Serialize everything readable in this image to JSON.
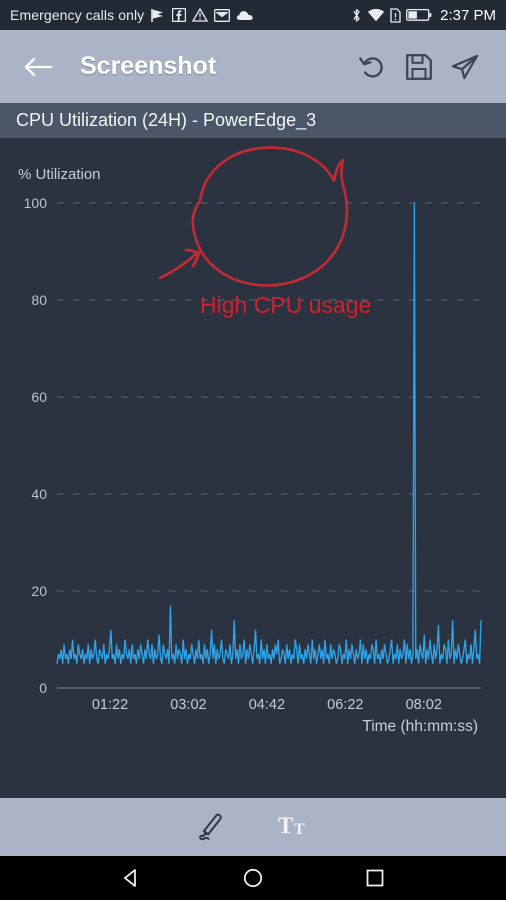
{
  "status_bar": {
    "carrier": "Emergency calls only",
    "clock": "2:37 PM",
    "left_icons": [
      "flag-icon",
      "facebook-icon",
      "warning-triangle-icon",
      "email-icon",
      "cloud-icon"
    ],
    "right_icons": [
      "bluetooth-icon",
      "wifi-icon",
      "sim-alert-icon",
      "battery-icon"
    ],
    "background": "#232a36"
  },
  "app_bar": {
    "back_label": "back-arrow",
    "title": "Screenshot",
    "actions": [
      {
        "name": "undo-button",
        "icon": "undo-icon"
      },
      {
        "name": "save-button",
        "icon": "floppy-disk-icon"
      },
      {
        "name": "share-button",
        "icon": "paper-plane-icon"
      }
    ],
    "background": "#aab4c6"
  },
  "subtitle": {
    "text": "CPU Utilization (24H) - PowerEdge_3",
    "background": "#4b5668"
  },
  "edit_toolbar": {
    "tools": [
      {
        "name": "draw-tool-button",
        "icon": "pen-icon",
        "selected": true
      },
      {
        "name": "text-tool-button",
        "icon": "text-format-icon",
        "selected": false
      }
    ],
    "background": "#aab4c6"
  },
  "nav_bar": {
    "buttons": [
      {
        "name": "nav-back-button",
        "icon": "triangle-back-icon"
      },
      {
        "name": "nav-home-button",
        "icon": "circle-home-icon"
      },
      {
        "name": "nav-recents-button",
        "icon": "square-recents-icon"
      }
    ],
    "background": "#000000"
  },
  "annotations": {
    "color": "#d32030",
    "text": "High CPU usage",
    "shapes": [
      "freehand-ellipse",
      "freehand-arrow"
    ]
  },
  "chart_data": {
    "type": "line",
    "title": "CPU Utilization (24H) - PowerEdge_3",
    "ylabel": "% Utilization",
    "xlabel": "Time (hh:mm:ss)",
    "ylim": [
      0,
      100
    ],
    "yticks": [
      0,
      20,
      40,
      60,
      80,
      100
    ],
    "ytick_labels": [
      "0",
      "20",
      "40",
      "60",
      "80",
      "100"
    ],
    "xtick_labels": [
      "01:22",
      "03:02",
      "04:42",
      "06:22",
      "08:02"
    ],
    "xtick_positions": [
      0.125,
      0.31,
      0.495,
      0.68,
      0.865
    ],
    "grid": "dashed-horizontal",
    "legend": "none",
    "line_color": "#2fa3e8",
    "background": "#2b3240",
    "series": [
      {
        "name": "CPU Utilization",
        "baseline": 6,
        "peak": 100,
        "peak_x_fraction": 0.825,
        "peak_label": "100",
        "secondary_peaks": [
          {
            "x_fraction": 0.215,
            "value": 17
          },
          {
            "x_fraction": 0.385,
            "value": 14
          },
          {
            "x_fraction": 0.44,
            "value": 12
          },
          {
            "x_fraction": 0.895,
            "value": 11
          },
          {
            "x_fraction": 0.955,
            "value": 13
          },
          {
            "x_fraction": 0.985,
            "value": 14
          }
        ],
        "values": [
          5,
          7,
          6,
          8,
          5,
          9,
          6,
          7,
          5,
          8,
          6,
          10,
          6,
          7,
          5,
          9,
          7,
          6,
          8,
          5,
          7,
          6,
          9,
          5,
          8,
          6,
          7,
          10,
          6,
          5,
          8,
          7,
          6,
          9,
          5,
          7,
          6,
          8,
          12,
          6,
          7,
          5,
          9,
          6,
          8,
          5,
          7,
          6,
          10,
          7,
          6,
          8,
          5,
          9,
          6,
          7,
          5,
          8,
          6,
          9,
          7,
          5,
          8,
          6,
          10,
          7,
          6,
          9,
          5,
          8,
          6,
          7,
          11,
          6,
          5,
          9,
          7,
          6,
          8,
          5,
          17,
          6,
          7,
          5,
          9,
          6,
          8,
          7,
          5,
          10,
          6,
          8,
          5,
          7,
          6,
          9,
          7,
          5,
          8,
          6,
          10,
          6,
          7,
          5,
          9,
          6,
          8,
          5,
          7,
          12,
          6,
          9,
          5,
          8,
          6,
          7,
          10,
          6,
          5,
          8,
          7,
          6,
          9,
          5,
          7,
          14,
          6,
          8,
          5,
          9,
          6,
          7,
          10,
          5,
          8,
          6,
          9,
          7,
          5,
          8,
          12,
          6,
          7,
          5,
          10,
          6,
          8,
          5,
          9,
          6,
          7,
          5,
          8,
          6,
          9,
          7,
          10,
          5,
          6,
          8,
          7,
          5,
          9,
          6,
          8,
          5,
          7,
          6,
          10,
          8,
          5,
          9,
          6,
          7,
          5,
          8,
          6,
          9,
          7,
          5,
          10,
          6,
          8,
          5,
          7,
          9,
          6,
          8,
          5,
          10,
          6,
          7,
          5,
          9,
          6,
          8,
          7,
          5,
          6,
          9,
          8,
          5,
          7,
          6,
          10,
          5,
          8,
          6,
          9,
          7,
          5,
          8,
          6,
          7,
          10,
          5,
          9,
          6,
          8,
          5,
          7,
          6,
          9,
          8,
          5,
          10,
          6,
          7,
          5,
          8,
          6,
          9,
          7,
          5,
          6,
          8,
          10,
          5,
          7,
          6,
          9,
          5,
          8,
          6,
          7,
          10,
          5,
          9,
          6,
          8,
          5,
          7,
          100,
          6,
          8,
          5,
          9,
          7,
          6,
          11,
          5,
          8,
          6,
          10,
          7,
          5,
          9,
          6,
          8,
          13,
          5,
          7,
          6,
          9,
          8,
          5,
          10,
          6,
          7,
          14,
          5,
          8,
          6,
          9,
          7,
          5,
          6,
          8,
          10,
          5,
          7,
          6,
          9,
          5,
          8,
          12,
          6,
          7,
          5,
          14
        ]
      }
    ]
  }
}
